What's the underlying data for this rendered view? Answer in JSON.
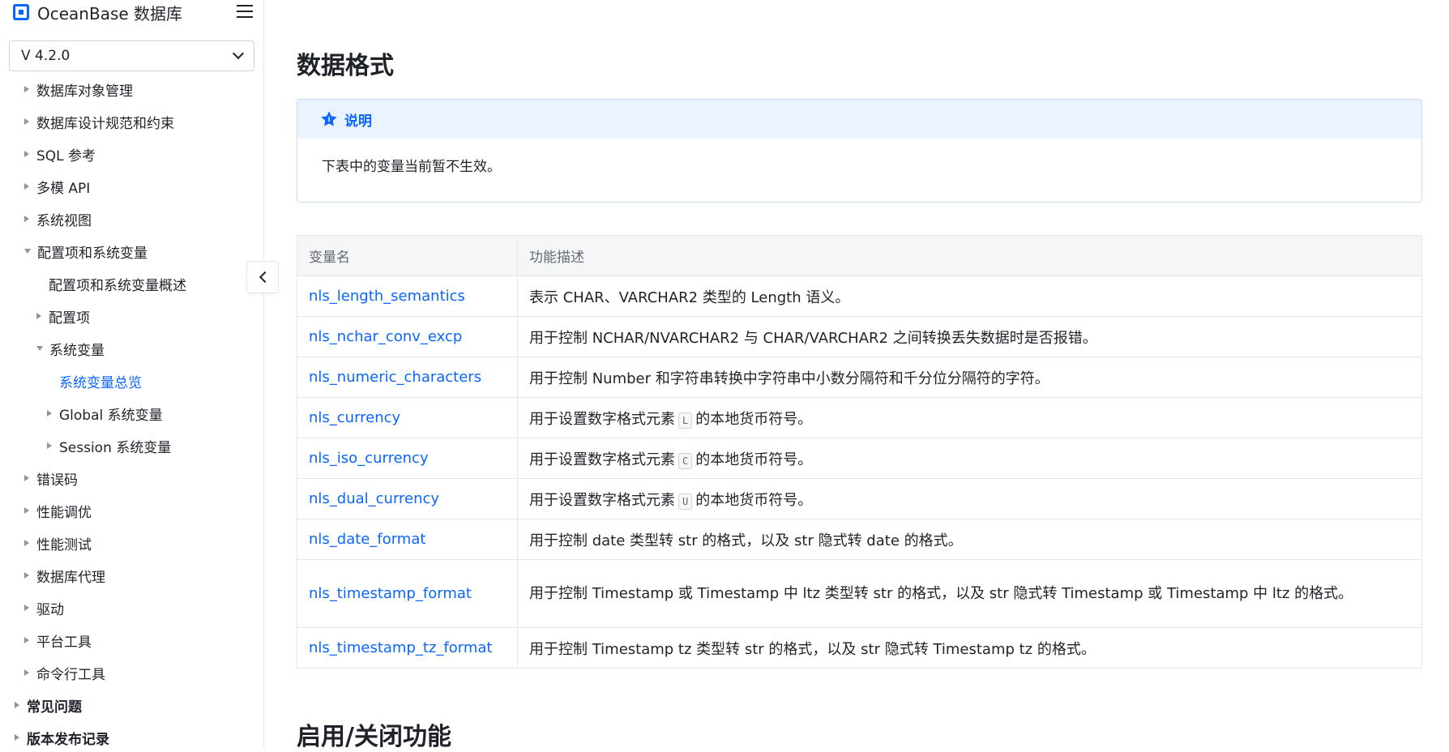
{
  "brand": {
    "name": "OceanBase 数据库"
  },
  "version": {
    "value": "V 4.2.0"
  },
  "nav": [
    {
      "label": "数据库对象管理",
      "indent": 1,
      "state": "closed"
    },
    {
      "label": "数据库设计规范和约束",
      "indent": 1,
      "state": "closed"
    },
    {
      "label": "SQL 参考",
      "indent": 1,
      "state": "closed"
    },
    {
      "label": "多模 API",
      "indent": 1,
      "state": "closed"
    },
    {
      "label": "系统视图",
      "indent": 1,
      "state": "closed"
    },
    {
      "label": "配置项和系统变量",
      "indent": 1,
      "state": "open"
    },
    {
      "label": "配置项和系统变量概述",
      "indent": 2,
      "state": "none"
    },
    {
      "label": "配置项",
      "indent": 2,
      "state": "closed"
    },
    {
      "label": "系统变量",
      "indent": 2,
      "state": "open"
    },
    {
      "label": "系统变量总览",
      "indent": 3,
      "state": "none",
      "active": true
    },
    {
      "label": "Global 系统变量",
      "indent": 3,
      "state": "closed"
    },
    {
      "label": "Session 系统变量",
      "indent": 3,
      "state": "closed"
    },
    {
      "label": "错误码",
      "indent": 1,
      "state": "closed"
    },
    {
      "label": "性能调优",
      "indent": 1,
      "state": "closed"
    },
    {
      "label": "性能测试",
      "indent": 1,
      "state": "closed"
    },
    {
      "label": "数据库代理",
      "indent": 1,
      "state": "closed"
    },
    {
      "label": "驱动",
      "indent": 1,
      "state": "closed"
    },
    {
      "label": "平台工具",
      "indent": 1,
      "state": "closed"
    },
    {
      "label": "命令行工具",
      "indent": 1,
      "state": "closed"
    },
    {
      "label": "常见问题",
      "indent": 0,
      "state": "closed",
      "bold": true
    },
    {
      "label": "版本发布记录",
      "indent": 0,
      "state": "closed",
      "bold": true
    }
  ],
  "main": {
    "title": "数据格式",
    "note": {
      "title": "说明",
      "body": "下表中的变量当前暂不生效。"
    },
    "table": {
      "headers": [
        "变量名",
        "功能描述"
      ],
      "rows": [
        {
          "name": "nls_length_semantics",
          "desc": [
            "表示 CHAR、VARCHAR2 类型的 Length 语义。"
          ]
        },
        {
          "name": "nls_nchar_conv_excp",
          "desc": [
            "用于控制 NCHAR/NVARCHAR2 与 CHAR/VARCHAR2 之间转换丢失数据时是否报错。"
          ]
        },
        {
          "name": "nls_numeric_characters",
          "desc": [
            "用于控制 Number 和字符串转换中字符串中小数分隔符和千分位分隔符的字符。"
          ]
        },
        {
          "name": "nls_currency",
          "desc": [
            "用于设置数字格式元素",
            "L",
            "的本地货币符号。"
          ]
        },
        {
          "name": "nls_iso_currency",
          "desc": [
            "用于设置数字格式元素",
            "C",
            "的本地货币符号。"
          ]
        },
        {
          "name": "nls_dual_currency",
          "desc": [
            "用于设置数字格式元素",
            "U",
            "的本地货币符号。"
          ]
        },
        {
          "name": "nls_date_format",
          "desc": [
            "用于控制 date 类型转 str 的格式，以及 str 隐式转 date 的格式。"
          ]
        },
        {
          "name": "nls_timestamp_format",
          "desc": [
            "用于控制 Timestamp 或 Timestamp 中 ltz 类型转 str 的格式，以及 str 隐式转 Timestamp 或 Timestamp 中 ltz 的格式。"
          ],
          "tall": true
        },
        {
          "name": "nls_timestamp_tz_format",
          "desc": [
            "用于控制 Timestamp tz 类型转 str 的格式，以及 str 隐式转 Timestamp tz 的格式。"
          ]
        }
      ]
    },
    "next_title": "启用/关闭功能"
  }
}
